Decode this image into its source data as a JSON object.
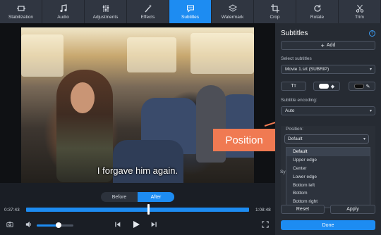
{
  "toolbar": {
    "tools": [
      {
        "label": "Stabilization",
        "icon": "stabilization-icon"
      },
      {
        "label": "Audio",
        "icon": "music-note-icon"
      },
      {
        "label": "Adjustments",
        "icon": "adjustments-icon"
      },
      {
        "label": "Effects",
        "icon": "magic-wand-icon"
      },
      {
        "label": "Subtitles",
        "icon": "subtitles-icon",
        "active": true
      },
      {
        "label": "Watermark",
        "icon": "watermark-icon"
      },
      {
        "label": "Crop",
        "icon": "crop-icon"
      },
      {
        "label": "Rotate",
        "icon": "rotate-icon"
      },
      {
        "label": "Trim",
        "icon": "scissors-icon"
      }
    ]
  },
  "preview": {
    "subtitle": "I forgave him again.",
    "callout": "Position"
  },
  "timeline": {
    "before_label": "Before",
    "after_label": "After",
    "start_time": "0:37:43",
    "end_time": "1:08:48",
    "volume": 0.6
  },
  "panel": {
    "title": "Subtitles",
    "add_label": "Add",
    "select_label": "Select subtitles",
    "selected_subtitle": "Movie 1.srt (SUBRIP)",
    "text_style_label": "Tт",
    "encoding_label": "Subtitle encoding:",
    "encoding_value": "Auto",
    "position_label": "Position:",
    "position_value": "Default",
    "position_options": [
      "Default",
      "Upper edge",
      "Center",
      "Lower edge",
      "Bottom left",
      "Bottom",
      "Bottom right"
    ],
    "sync_label": "Sy",
    "reset_label": "Reset",
    "apply_label": "Apply",
    "done_label": "Done"
  },
  "colors": {
    "accent": "#1d8cf2",
    "callout": "#f07a52",
    "panel_bg": "#262b33"
  }
}
